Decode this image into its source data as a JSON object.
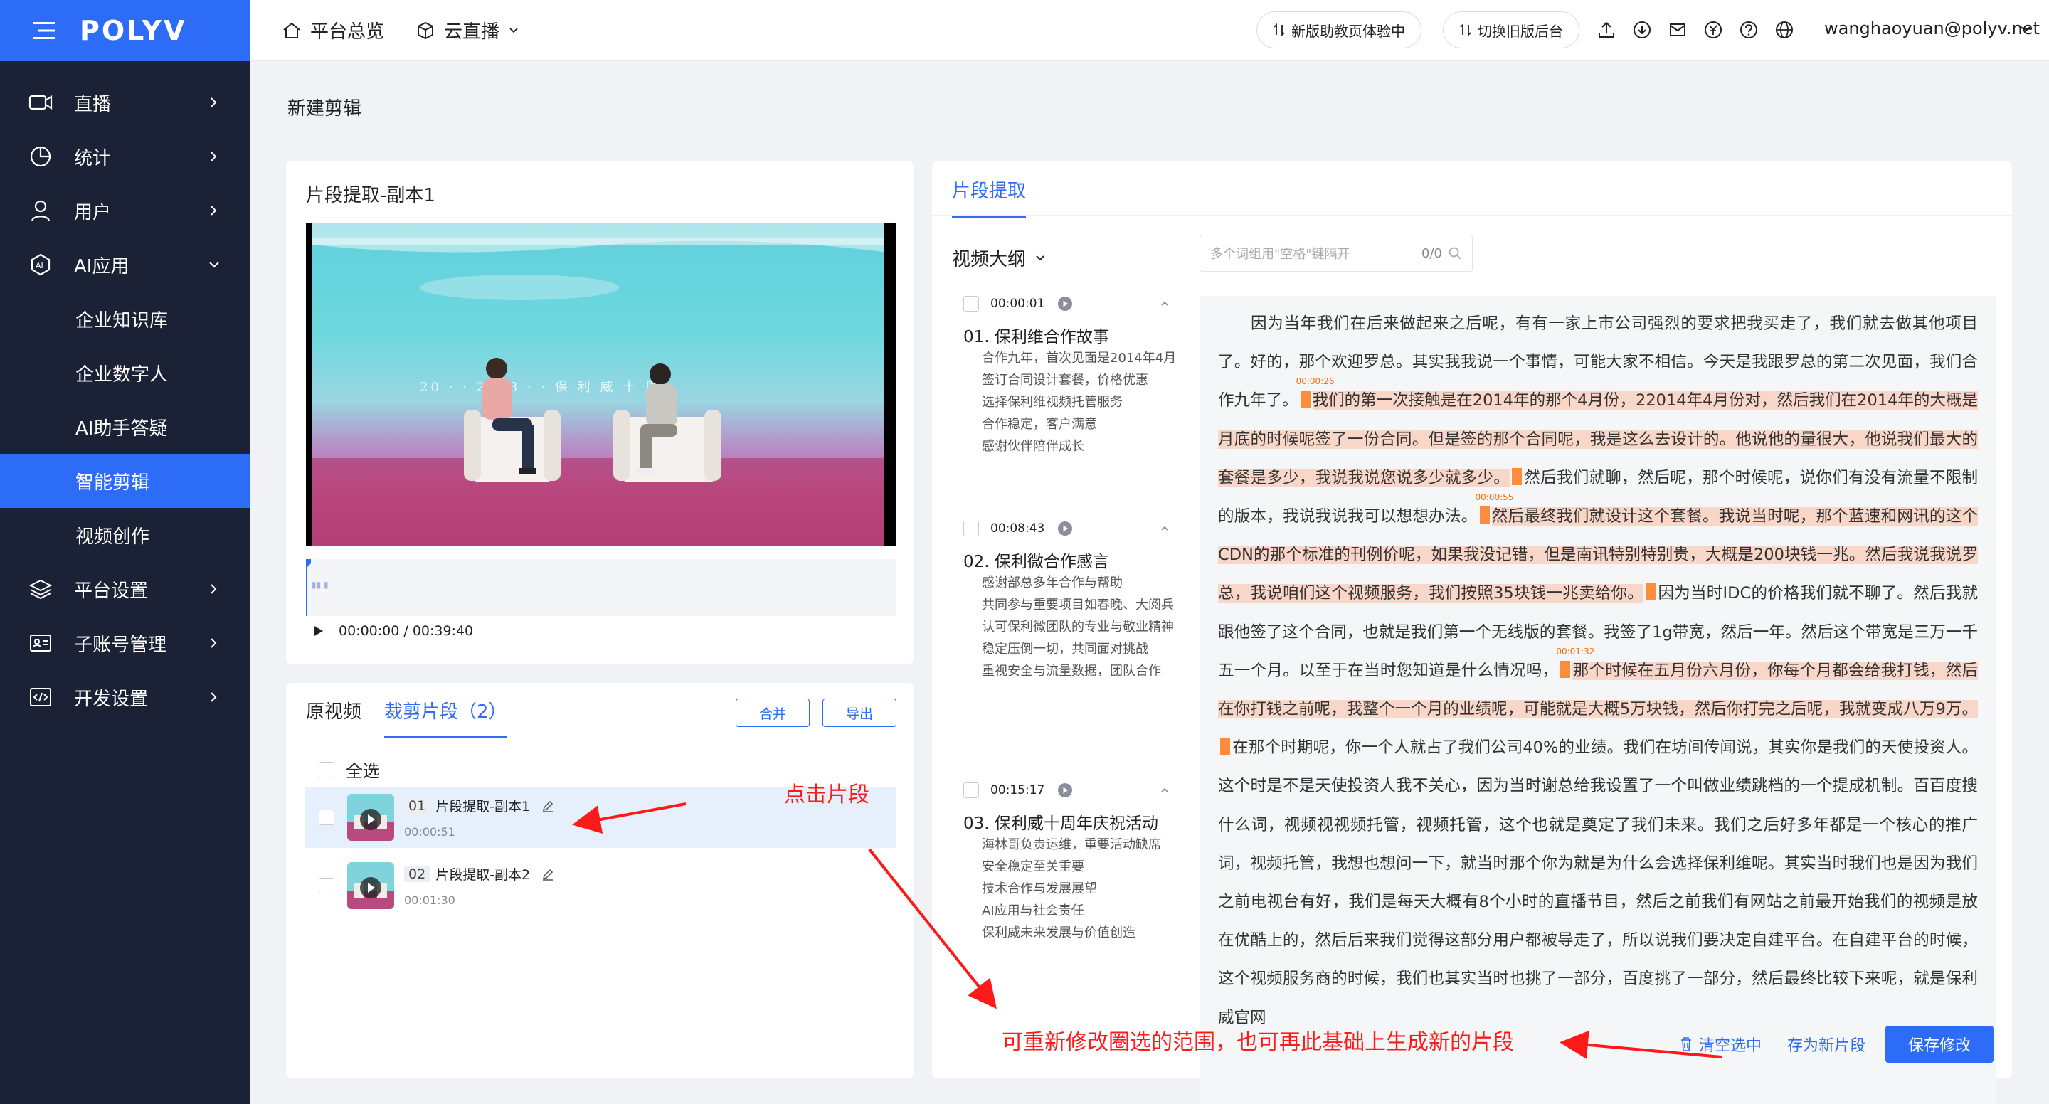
{
  "brand": {
    "logo": "POLYV",
    "primary": "#2c6cf6",
    "sidebar_bg": "#1b2236",
    "annotation": "#ff1a1a"
  },
  "sidebar": {
    "items": [
      {
        "label": "直播",
        "icon": "video-camera-icon"
      },
      {
        "label": "统计",
        "icon": "pie-chart-icon"
      },
      {
        "label": "用户",
        "icon": "user-icon"
      },
      {
        "label": "AI应用",
        "icon": "ai-icon",
        "expanded": true
      }
    ],
    "sub_items": [
      {
        "label": "企业知识库"
      },
      {
        "label": "企业数字人"
      },
      {
        "label": "AI助手答疑"
      },
      {
        "label": "智能剪辑",
        "active": true
      },
      {
        "label": "视频创作"
      }
    ],
    "bottom_items": [
      {
        "label": "平台设置",
        "icon": "layers-icon"
      },
      {
        "label": "子账号管理",
        "icon": "id-card-icon"
      },
      {
        "label": "开发设置",
        "icon": "code-icon"
      }
    ]
  },
  "topbar": {
    "home": "平台总览",
    "live": "云直播",
    "btn_new": "新版助教页体验中",
    "btn_switch": "切换旧版后台",
    "user": "wanghaoyuan@polyv.net"
  },
  "page_title": "新建剪辑",
  "video_card": {
    "title": "片段提取-副本1",
    "stage_banner": "20 · · 2023 · · 保 利 威 十 周",
    "time": "00:00:00 / 00:39:40"
  },
  "clips_card": {
    "tab_original": "原视频",
    "tab_clips": "裁剪片段（2）",
    "btn_merge": "合并",
    "btn_export": "导出",
    "select_all": "全选",
    "clips": [
      {
        "num": "01",
        "name": "片段提取-副本1",
        "duration": "00:00:51",
        "active": true
      },
      {
        "num": "02",
        "name": "片段提取-副本2",
        "duration": "00:01:30",
        "active": false
      }
    ]
  },
  "right_panel": {
    "tab": "片段提取",
    "outline_title": "视频大纲",
    "search_placeholder": "多个词组用\"空格\"键隔开",
    "search_count": "0/0",
    "outline": [
      {
        "time": "00:00:01",
        "title": "01. 保利维合作故事",
        "items": [
          "合作九年，首次见面是2014年4月",
          "签订合同设计套餐，价格优惠",
          "选择保利维视频托管服务",
          "合作稳定，客户满意",
          "感谢伙伴陪伴成长"
        ]
      },
      {
        "time": "00:08:43",
        "title": "02. 保利微合作感言",
        "items": [
          "感谢部总多年合作与帮助",
          "共同参与重要项目如春晚、大阅兵",
          "认可保利微团队的专业与敬业精神",
          "稳定压倒一切，共同面对挑战",
          "重视安全与流量数据，团队合作"
        ]
      },
      {
        "time": "00:15:17",
        "title": "03. 保利威十周年庆祝活动",
        "items": [
          "海林哥负责运维，重要活动缺席",
          "安全稳定至关重要",
          "技术合作与发展展望",
          "AI应用与社会责任",
          "保利威未来发展与价值创造"
        ]
      }
    ],
    "transcript": {
      "t1": "因为当年我们在后来做起来之后呢，有有一家上市公司强烈的要求把我买走了，我们就去做其他项目了。好的，那个欢迎罗总。其实我我说一个事情，可能大家不相信。今天是我跟罗总的第二次见面，我们合作九年了。",
      "m1": "00:00:26",
      "h1": "我们的第一次接触是在2014年的那个4月份，22014年4月份对，然后我们在2014年的大概是月底的时候呢签了一份合同。但是签的那个合同呢，我是这么去设计的。他说他的量很大，他说我们最大的套餐是多少，我说我说您说多少就多少。",
      "t2": "然后我们就聊，然后呢，那个时候呢，说你们有没有流量不限制的版本，我说我说我可以想想办法。",
      "m2": "00:00:55",
      "h2": "然后最终我们就设计这个套餐。我说当时呢，那个蓝速和网讯的这个CDN的那个标准的刊例价呢，如果我没记错，但是南讯特别特别贵，大概是200块钱一兆。然后我说我说罗总，我说咱们这个视频服务，我们按照35块钱一兆卖给你。",
      "t3": "因为当时IDC的价格我们就不聊了。然后我就跟他签了这个合同，也就是我们第一个无线版的套餐。我签了1g带宽，然后一年。然后这个带宽是三万一千五一个月。以至于在当时您知道是什么情况吗，",
      "m3": "00:01:32",
      "h3": "那个时候在五月份六月份，你每个月都会给我打钱，然后在你打钱之前呢，我整个一个月的业绩呢，可能就是大概5万块钱，然后你打完之后呢，我就变成八万9万。",
      "t4": "在那个时期呢，你一个人就占了我们公司40%的业绩。我们在坊间传闻说，其实你是我们的天使投资人。这个时是不是天使投资人我不关心，因为当时谢总给我设置了一个叫做业绩跳档的一个提成机制。百百度搜什么词，视频视视频托管，视频托管，这个也就是奠定了我们未来。我们之后好多年都是一个核心的推广词，视频托管，我想也想问一下，就当时那个你为就是为什么会选择保利维呢。其实当时我们也是因为我们之前电视台有好，我们是每天大概有8个小时的直播节目，然后之前我们有网站之前最开始我们的视频是放在优酷上的，然后后来我们觉得这部分用户都被导走了，所以说我们要决定自建平台。在自建平台的时候，这个视频服务商的时候，我们也其实当时也挑了一部分，百度挑了一部分，然后最终比较下来呢，就是保利威官网"
    },
    "btn_clear": "清空选中",
    "btn_save_new": "存为新片段",
    "btn_save": "保存修改"
  },
  "annotations": {
    "click_clip": "点击片段",
    "modify_range": "可重新修改圈选的范围，也可再此基础上生成新的片段"
  }
}
